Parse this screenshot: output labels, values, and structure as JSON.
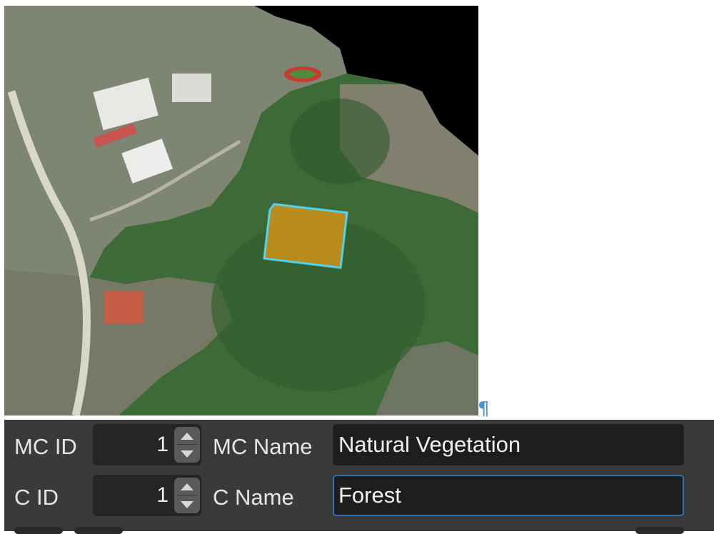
{
  "colors": {
    "panel_bg": "#3a3a3a",
    "field_bg": "#1e1e1e",
    "focus_ring": "#2d6fb8",
    "polygon_fill": "#c8901a",
    "polygon_stroke": "#4fd3ef",
    "pilcrow": "#4a90d9"
  },
  "map": {
    "pilcrow_glyph": "¶",
    "selected_polygon_icon": "polygon-selection"
  },
  "form": {
    "mc_id_label": "MC ID",
    "mc_id_value": "1",
    "mc_name_label": "MC Name",
    "mc_name_value": "Natural Vegetation",
    "c_id_label": "C ID",
    "c_id_value": "1",
    "c_name_label": "C Name",
    "c_name_value": "Forest"
  }
}
